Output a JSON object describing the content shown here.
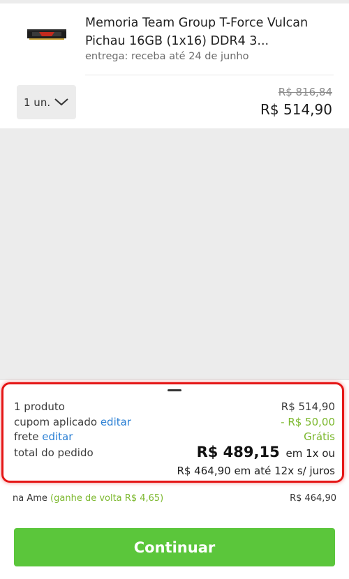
{
  "product": {
    "name": "Memoria Team Group T-Force Vulcan Pichau 16GB (1x16) DDR4 3...",
    "delivery": "entrega: receba até 24 de junho",
    "quantity": "1 un.",
    "price_old": "R$ 816,84",
    "price_current": "R$ 514,90"
  },
  "summary": {
    "products_label": "1 produto",
    "products_value": "R$ 514,90",
    "coupon_label": "cupom aplicado",
    "coupon_link": "editar",
    "coupon_value": "- R$ 50,00",
    "shipping_label": "frete",
    "shipping_link": "editar",
    "shipping_value": "Grátis",
    "total_label": "total do pedido",
    "total_value": "R$ 489,15",
    "total_suffix": "em 1x ou",
    "installments": "R$ 464,90 em até 12x s/ juros",
    "ame_label": "na Ame",
    "ame_cashback": "(ganhe de volta R$ 4,65)",
    "ame_value": "R$ 464,90"
  },
  "actions": {
    "continue_label": "Continuar"
  },
  "colors": {
    "accent_green": "#5bc63b",
    "discount_green": "#7cb82e",
    "link_blue": "#2a7fd4",
    "highlight_red": "#e51616"
  },
  "icons": {
    "product": "ram-module-image",
    "quantity": "chevron-down-icon"
  }
}
